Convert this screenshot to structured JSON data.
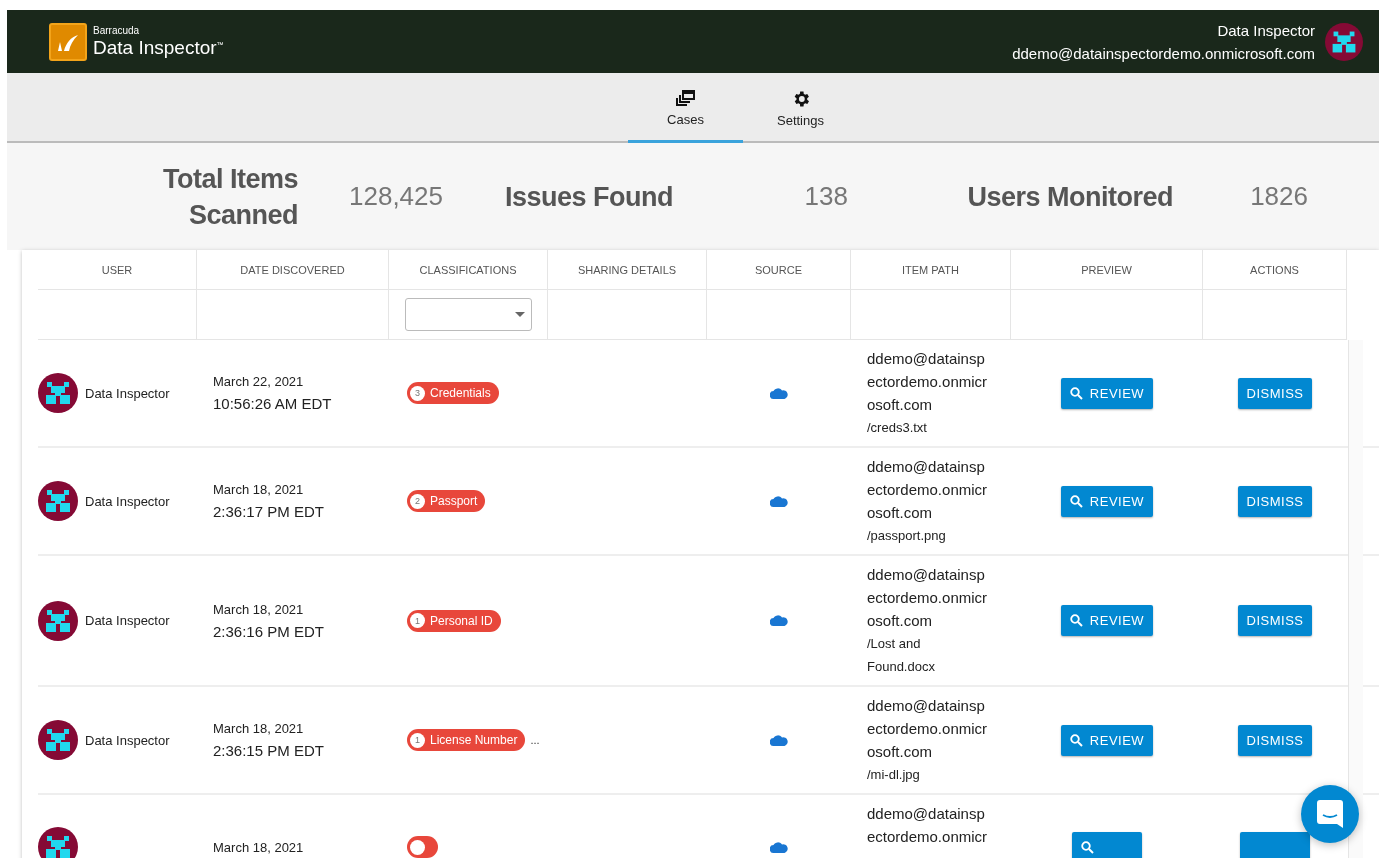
{
  "brand": {
    "company": "Barracuda",
    "product": "Data Inspector",
    "mark": "™"
  },
  "account": {
    "name": "Data Inspector",
    "email": "ddemo@datainspectordemo.onmicrosoft.com"
  },
  "tabs": [
    {
      "label": "Cases",
      "kind": "cases",
      "selected": true
    },
    {
      "label": "Settings",
      "kind": "settings",
      "selected": false
    }
  ],
  "stats": [
    {
      "label": "Total Items Scanned",
      "value": "128,425"
    },
    {
      "label": "Issues Found",
      "value": "138"
    },
    {
      "label": "Users Monitored",
      "value": "1826"
    }
  ],
  "table": {
    "columns": [
      "USER",
      "DATE DISCOVERED",
      "CLASSIFICATIONS",
      "SHARING DETAILS",
      "SOURCE",
      "ITEM PATH",
      "PREVIEW",
      "ACTIONS"
    ],
    "rows": [
      {
        "user": "Data Inspector",
        "date": "March 22, 2021",
        "time": "10:56:26 AM EDT",
        "badge": {
          "count": "3",
          "label": "Credentials"
        },
        "path": [
          "ddemo@datainsp",
          "ectordemo.onmicr",
          "osoft.com"
        ],
        "file": [
          "/creds3.txt"
        ],
        "actions": [
          {
            "kind": "review",
            "label": "REVIEW"
          },
          {
            "kind": "dismiss",
            "label": "DISMISS"
          }
        ]
      },
      {
        "user": "Data Inspector",
        "date": "March 18, 2021",
        "time": "2:36:17 PM EDT",
        "badge": {
          "count": "2",
          "label": "Passport"
        },
        "path": [
          "ddemo@datainsp",
          "ectordemo.onmicr",
          "osoft.com"
        ],
        "file": [
          "/passport.png"
        ],
        "actions": [
          {
            "kind": "review",
            "label": "REVIEW"
          },
          {
            "kind": "dismiss",
            "label": "DISMISS"
          }
        ]
      },
      {
        "user": "Data Inspector",
        "date": "March 18, 2021",
        "time": "2:36:16 PM EDT",
        "badge": {
          "count": "1",
          "label": "Personal ID"
        },
        "path": [
          "ddemo@datainsp",
          "ectordemo.onmicr",
          "osoft.com"
        ],
        "file": [
          "/Lost and",
          "Found.docx"
        ],
        "actions": [
          {
            "kind": "review",
            "label": "REVIEW"
          },
          {
            "kind": "dismiss",
            "label": "DISMISS"
          }
        ]
      },
      {
        "user": "Data Inspector",
        "date": "March 18, 2021",
        "time": "2:36:15 PM EDT",
        "badge": {
          "count": "1",
          "label": "License Number"
        },
        "more": "...",
        "path": [
          "ddemo@datainsp",
          "ectordemo.onmicr",
          "osoft.com"
        ],
        "file": [
          "/mi-dl.jpg"
        ],
        "actions": [
          {
            "kind": "review",
            "label": "REVIEW"
          },
          {
            "kind": "dismiss",
            "label": "DISMISS"
          }
        ]
      },
      {
        "date": "March 18, 2021",
        "badge": {},
        "path": [
          "ddemo@datainsp",
          "ectordemo.onmicr"
        ],
        "actions": [
          {
            "kind": "review"
          },
          {
            "kind": "dismiss"
          }
        ]
      }
    ]
  }
}
